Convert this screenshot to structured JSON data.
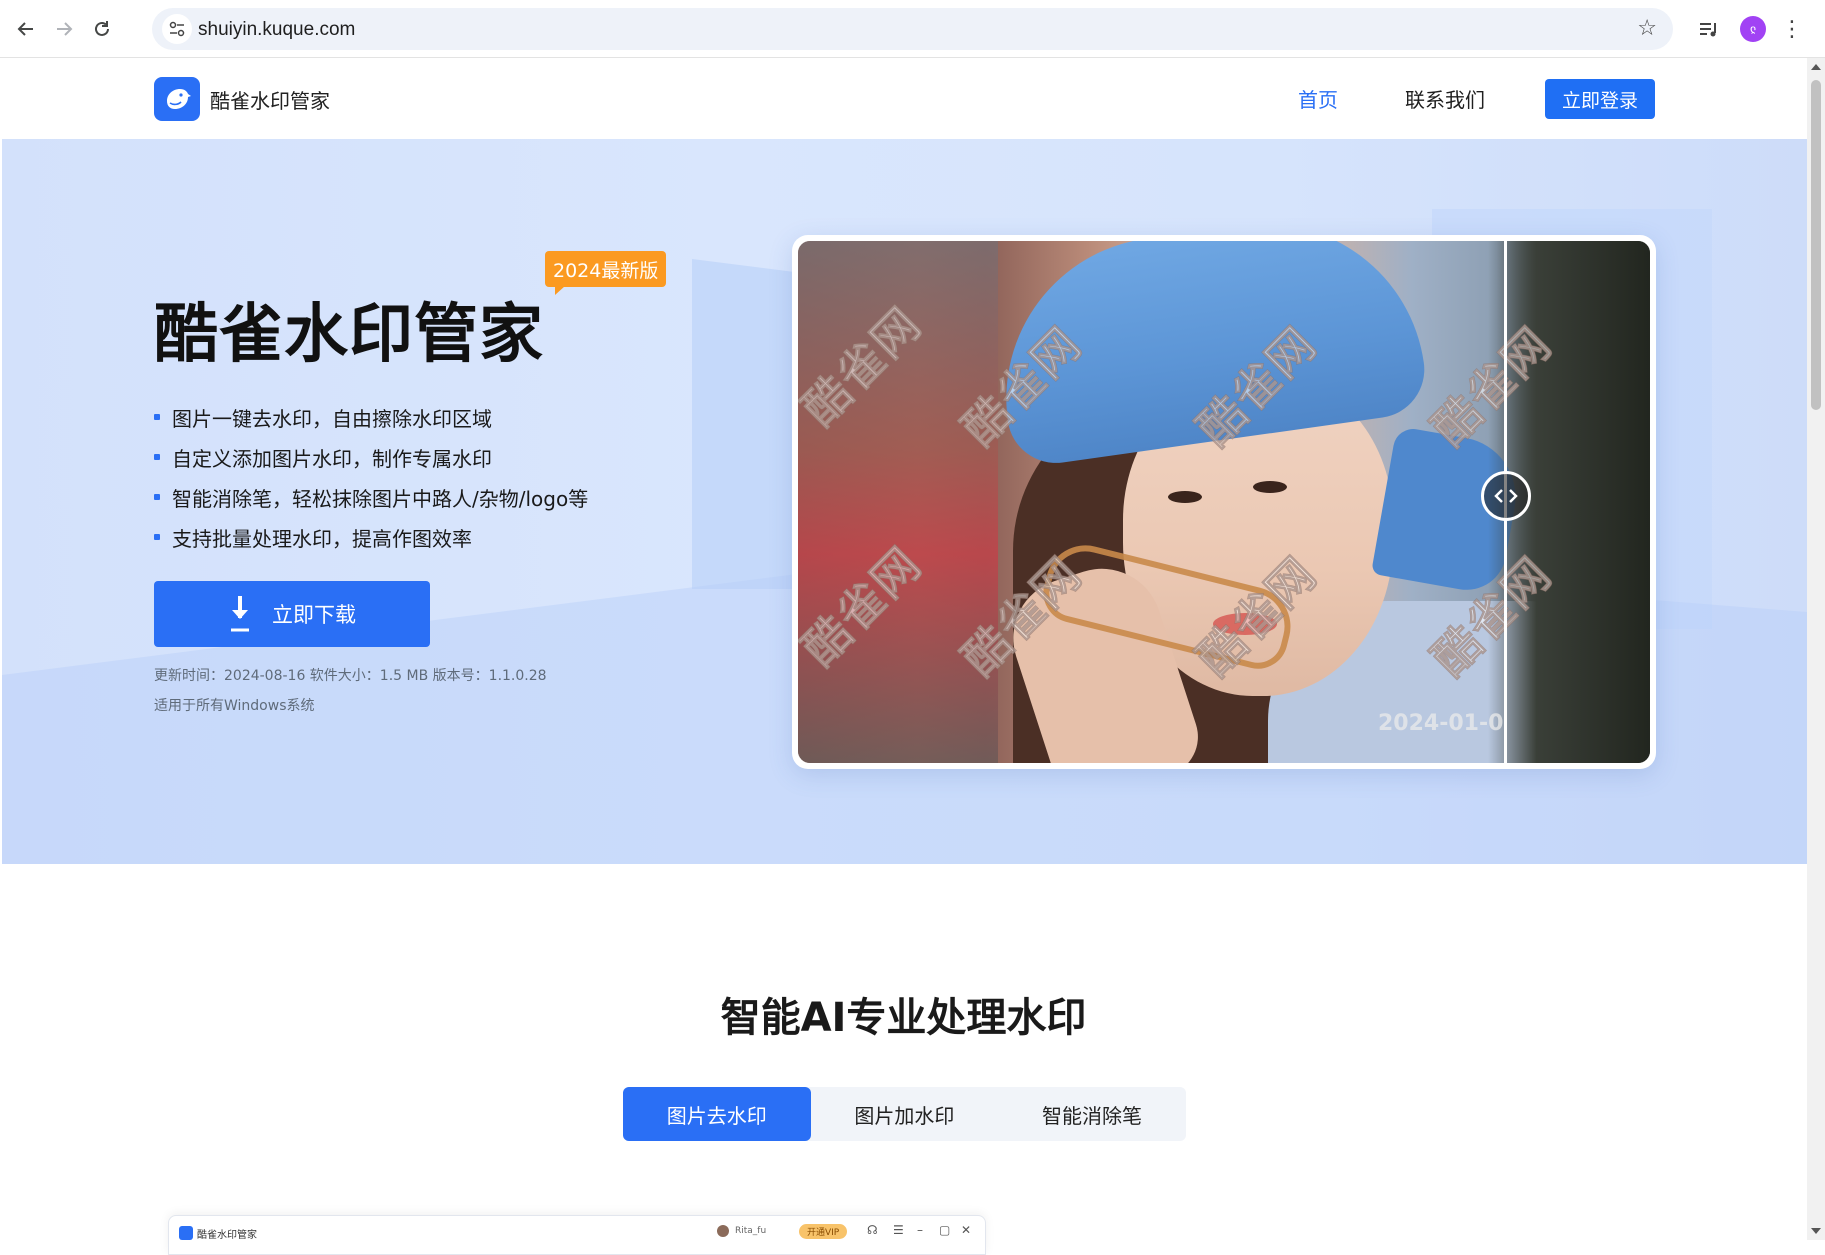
{
  "browser": {
    "url": "shuiyin.kuque.com",
    "profile_initial": "ჺ"
  },
  "header": {
    "logo_text": "酷雀水印管家",
    "nav": [
      {
        "label": "首页"
      },
      {
        "label": "联系我们"
      }
    ],
    "login_label": "立即登录"
  },
  "hero": {
    "title": "酷雀水印管家",
    "badge": "2024最新版",
    "features": [
      "图片一键去水印，自由擦除水印区域",
      "自定义添加图片水印，制作专属水印",
      "智能消除笔，轻松抹除图片中路人/杂物/logo等",
      "支持批量处理水印，提高作图效率"
    ],
    "download_label": "立即下载",
    "meta_line1": "更新时间：2024-08-16  软件大小：1.5 MB  版本号：1.1.0.28",
    "meta_line2": "适用于所有Windows系统",
    "watermarks": [
      "酷雀网",
      "酷雀网",
      "酷雀网",
      "酷雀网",
      "酷雀网",
      "酷雀网",
      "酷雀网",
      "酷雀网"
    ],
    "date_stamp": "2024-01-0"
  },
  "section": {
    "title": "智能AI专业处理水印",
    "tabs": [
      {
        "label": "图片去水印",
        "active": true
      },
      {
        "label": "图片加水印",
        "active": false
      },
      {
        "label": "智能消除笔",
        "active": false
      }
    ]
  },
  "app_preview": {
    "app_name": "酷雀水印管家",
    "user_name": "Rita_fu",
    "vip_label": "开通VIP"
  },
  "colors": {
    "accent": "#2a6ff5",
    "badge": "#fb9a21",
    "hero_bg": "#d6e4fc"
  }
}
